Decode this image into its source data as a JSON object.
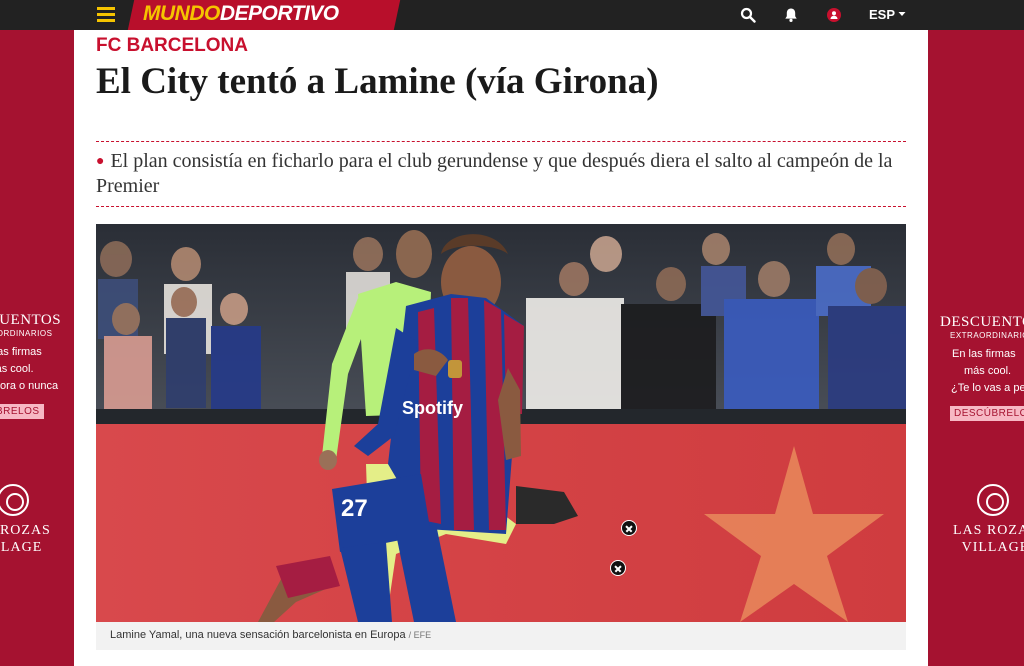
{
  "header": {
    "logo_part1": "MUNDO",
    "logo_part2": "DEPORTIVO",
    "lang": "ESP"
  },
  "article": {
    "kicker": "FC BARCELONA",
    "headline": "El City tentó a Lamine (vía Girona)",
    "summary": "El plan consistía en ficharlo para el club gerundense y que después diera el salto al campeón de la Premier",
    "caption": "Lamine Yamal, una nueva sensación barcelonista en Europa",
    "credit": "/ EFE",
    "jersey_number": "27",
    "sponsor": "Spotify"
  },
  "ad_left": {
    "title": "DESCUENTOS",
    "subtitle": "EXTRAORDINARIOS",
    "line1": "En las firmas",
    "line2": "más cool.",
    "line3": "¿Te lo vas a perder? Ahora o nunca",
    "button": "DESCÚBRELOS",
    "brand1": "LAS ROZAS",
    "brand2": "VILLAGE"
  },
  "ad_right": {
    "title": "DESCUENTOS",
    "subtitle": "EXTRAORDINARIOS",
    "line1": "En las firmas",
    "line2": "más cool.",
    "line3": "¿Te lo vas a perder?",
    "button": "DESCÚBRELOS",
    "brand1": "LAS ROZAS",
    "brand2": "VILLAGE"
  },
  "icons": [
    "menu-icon",
    "search-icon",
    "bell-icon",
    "user-icon",
    "chevron-down-icon",
    "close-icon"
  ],
  "colors": {
    "brand_red": "#c8102e",
    "logo_yellow": "#f5c400",
    "ad_red": "#a51230",
    "topbar": "#222222"
  }
}
